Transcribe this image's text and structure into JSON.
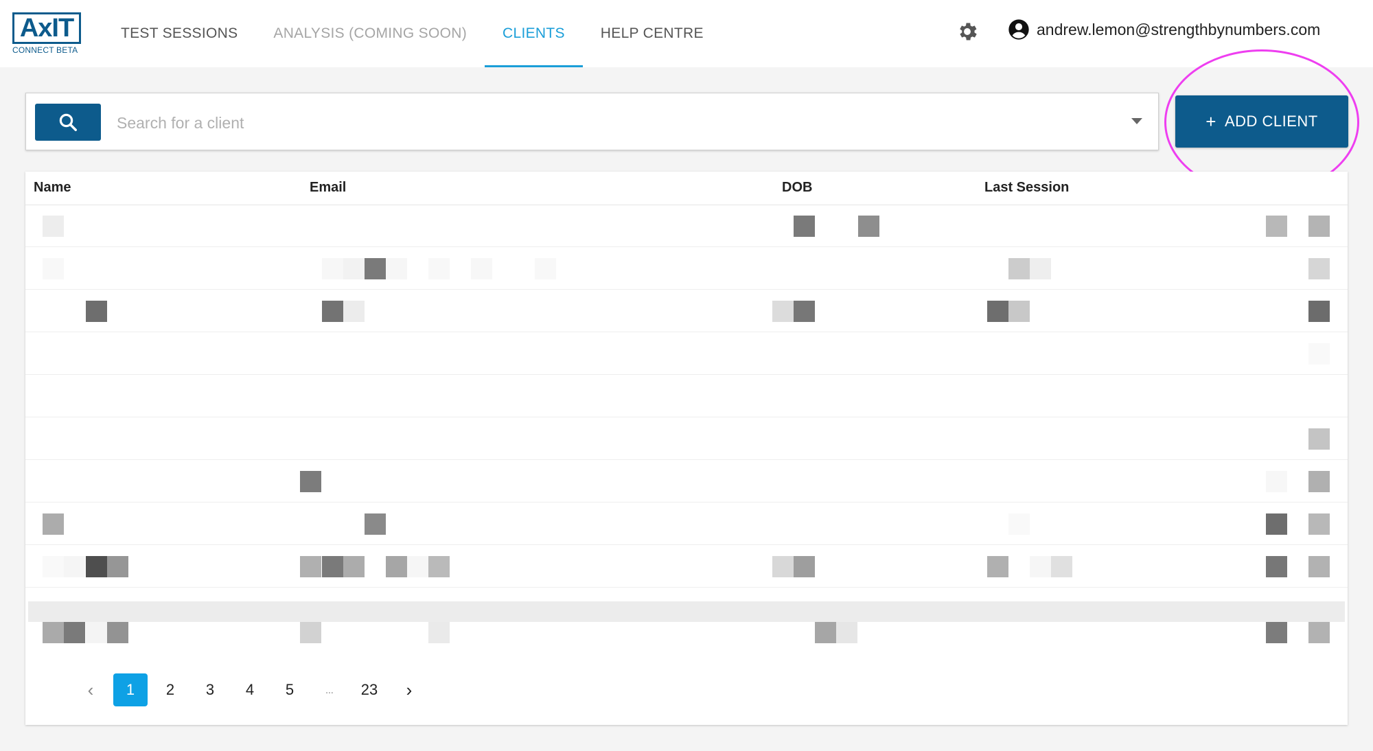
{
  "logo": {
    "text": "AxIT",
    "sub": "CONNECT BETA"
  },
  "nav": {
    "items": [
      {
        "label": "TEST SESSIONS"
      },
      {
        "label": "ANALYSIS (COMING SOON)"
      },
      {
        "label": "CLIENTS"
      },
      {
        "label": "HELP CENTRE"
      }
    ]
  },
  "user": {
    "email": "andrew.lemon@strengthbynumbers.com"
  },
  "search": {
    "placeholder": "Search for a client"
  },
  "add_client": {
    "plus": "+",
    "label": "ADD CLIENT"
  },
  "table": {
    "headers": {
      "name": "Name",
      "email": "Email",
      "dob": "DOB",
      "last_session": "Last Session"
    }
  },
  "pagination": {
    "prev": "‹",
    "pages": [
      "1",
      "2",
      "3",
      "4",
      "5",
      "...",
      "23"
    ],
    "next": "›"
  },
  "colors": {
    "primary": "#0d5b8c",
    "accent": "#1a9ed8",
    "active_page": "#0ea1e5",
    "highlight": "#ee3ef0"
  }
}
